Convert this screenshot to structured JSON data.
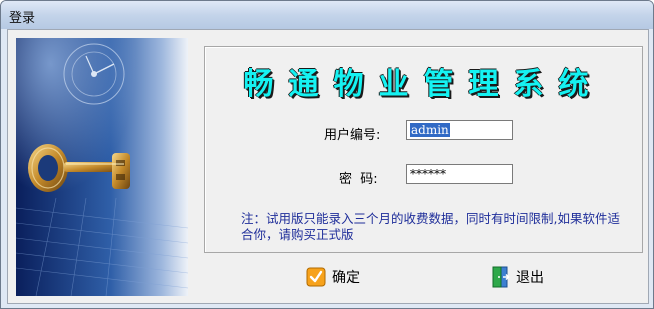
{
  "window": {
    "title": "登录"
  },
  "app": {
    "system_title": "畅通物业管理系统"
  },
  "form": {
    "user_label": "用户编号:",
    "user_value": "admin",
    "password_label": "密  码:",
    "password_value": "******"
  },
  "note": {
    "text": "注：试用版只能录入三个月的收费数据，同时有时间限制,如果软件适合你，请购买正式版"
  },
  "buttons": {
    "ok_label": "确定",
    "exit_label": "退出"
  },
  "icons": {
    "ok": "checkmark-icon",
    "exit": "exit-door-icon",
    "banner": "key-icon"
  },
  "colors": {
    "title_text": "#15f2f2",
    "note_text": "#1f2e9a",
    "selection": "#316ac5"
  }
}
